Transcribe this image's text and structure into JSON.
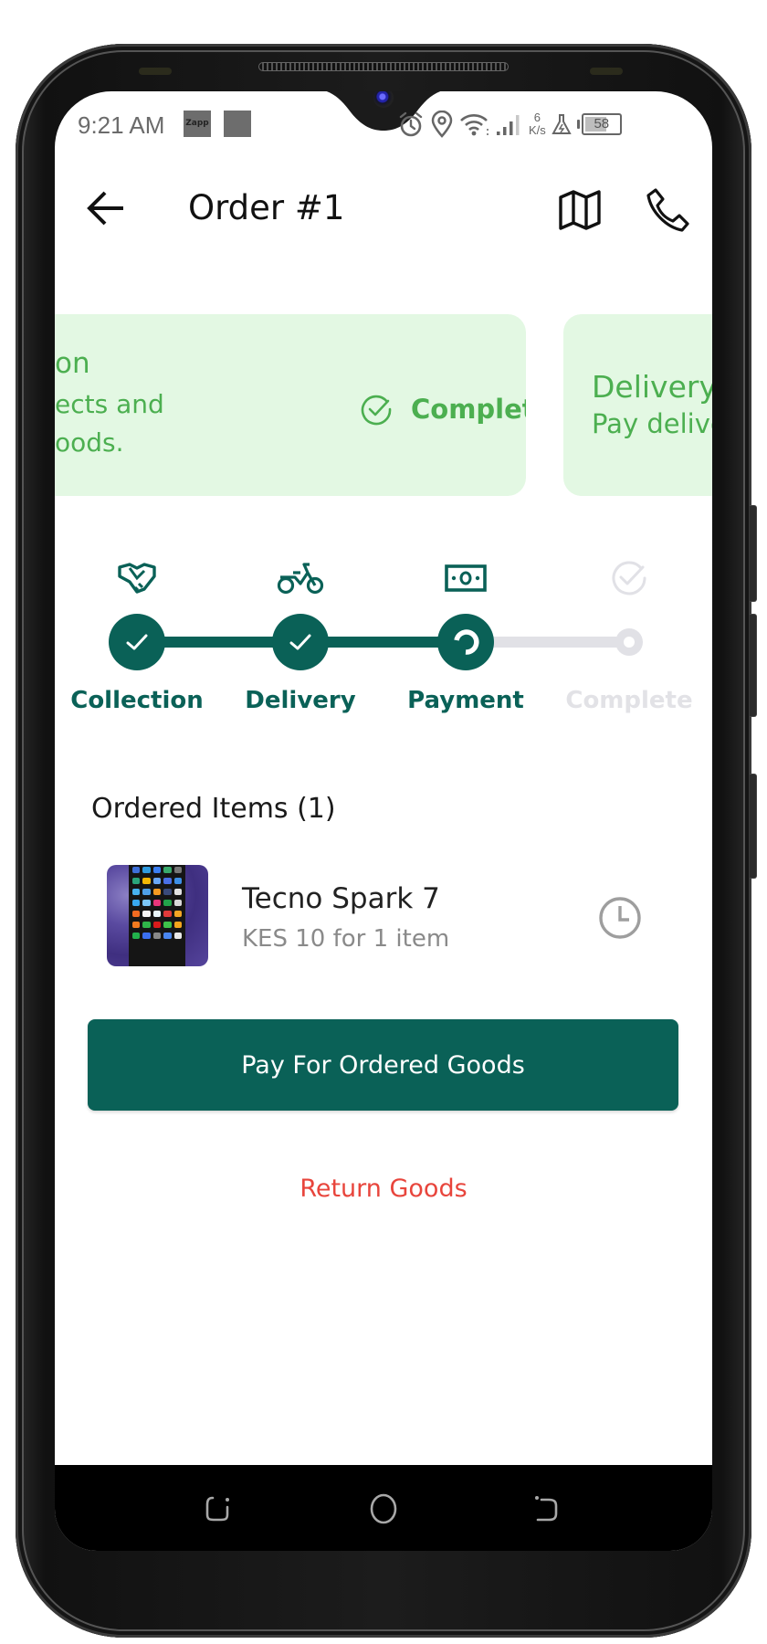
{
  "status_bar": {
    "time": "9:21 AM",
    "notification_app_label": "Zapp",
    "network_speed_value": "6",
    "network_speed_unit": "K/s",
    "battery_level": "58",
    "icons": [
      "alarm-icon",
      "location-icon",
      "wifi-icon",
      "signal-icon",
      "flask-icon",
      "battery-icon"
    ]
  },
  "header": {
    "title": "Order #1",
    "back_icon": "arrow-left-icon",
    "map_icon": "map-icon",
    "call_icon": "phone-icon"
  },
  "cards": [
    {
      "title_fragment": "on",
      "line2_fragment": "ects and",
      "line3_fragment": "oods.",
      "status": "Complete",
      "status_icon": "check-circle-icon"
    },
    {
      "title_fragment": "Delivery",
      "line2_fragment": "Pay delive"
    }
  ],
  "stepper": {
    "steps": [
      {
        "label": "Collection",
        "icon": "handshake-icon",
        "state": "done"
      },
      {
        "label": "Delivery",
        "icon": "motorbike-icon",
        "state": "done"
      },
      {
        "label": "Payment",
        "icon": "money-icon",
        "state": "in-progress"
      },
      {
        "label": "Complete",
        "icon": "check-circle-icon",
        "state": "pending"
      }
    ],
    "active_color": "#0a6157",
    "inactive_color": "#e1e1e6"
  },
  "ordered_items": {
    "title": "Ordered Items (1)",
    "items": [
      {
        "name": "Tecno Spark 7",
        "subtitle": "KES 10 for 1 item",
        "status_icon": "clock-icon"
      }
    ]
  },
  "actions": {
    "pay_label": "Pay For Ordered Goods",
    "return_label": "Return Goods"
  },
  "colors": {
    "primary": "#0a6157",
    "card_bg": "#e3f8e3",
    "card_text": "#4caf50",
    "danger": "#e8453c"
  }
}
